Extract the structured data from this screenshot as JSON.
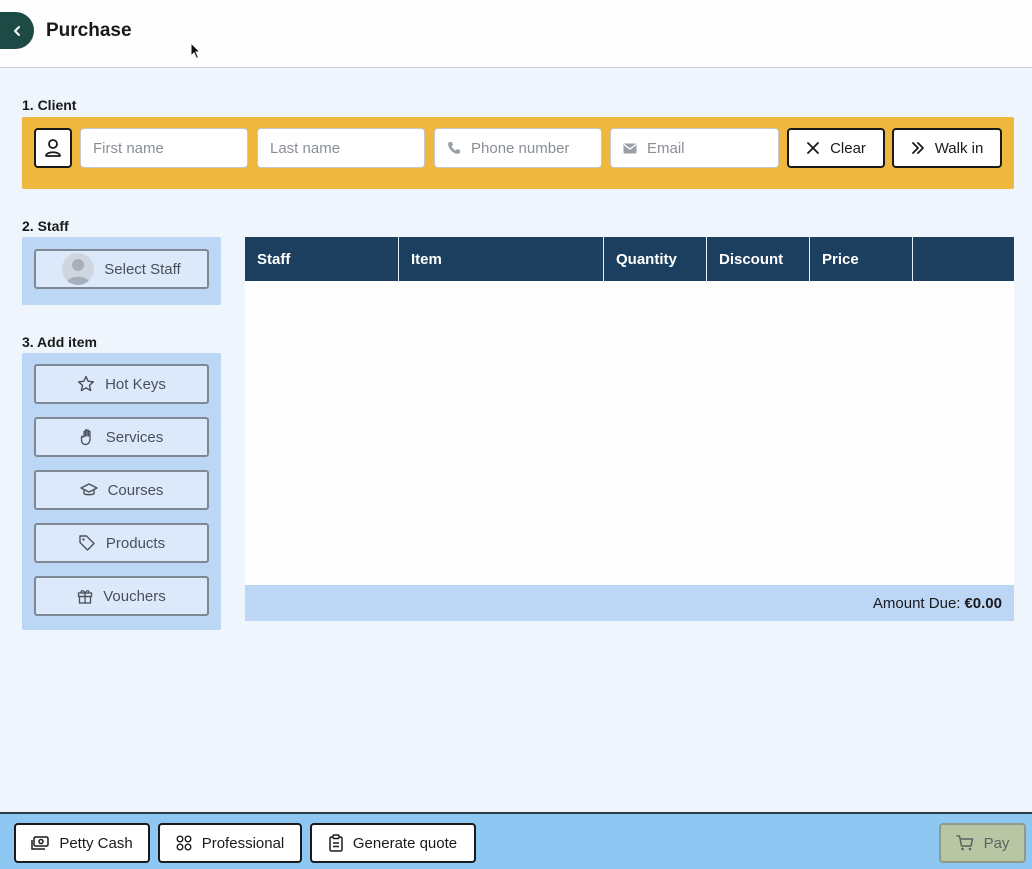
{
  "header": {
    "title": "Purchase",
    "back_icon": "chevron-left-icon"
  },
  "client": {
    "label": "1. Client",
    "first_name_placeholder": "First name",
    "last_name_placeholder": "Last name",
    "phone_placeholder": "Phone number",
    "email_placeholder": "Email",
    "clear_label": "Clear",
    "walk_in_label": "Walk in"
  },
  "staff": {
    "label": "2. Staff",
    "select_label": "Select Staff"
  },
  "add_item": {
    "label": "3. Add item",
    "buttons": [
      {
        "label": "Hot Keys",
        "icon": "star-icon"
      },
      {
        "label": "Services",
        "icon": "hand-icon"
      },
      {
        "label": "Courses",
        "icon": "graduation-cap-icon"
      },
      {
        "label": "Products",
        "icon": "tag-icon"
      },
      {
        "label": "Vouchers",
        "icon": "gift-icon"
      }
    ]
  },
  "table": {
    "columns": [
      "Staff",
      "Item",
      "Quantity",
      "Discount",
      "Price",
      ""
    ],
    "rows": [],
    "amount_due_label": "Amount Due:",
    "amount_due_value": "€0.00"
  },
  "bottom": {
    "petty_cash_label": "Petty Cash",
    "professional_label": "Professional",
    "generate_quote_label": "Generate quote",
    "pay_label": "Pay"
  },
  "colors": {
    "client_bar": "#efb73e",
    "table_header": "#1c3f5f",
    "panel": "#bcd6f5",
    "bottom_bar": "#8ec8f2",
    "back_button": "#1e4a45"
  }
}
